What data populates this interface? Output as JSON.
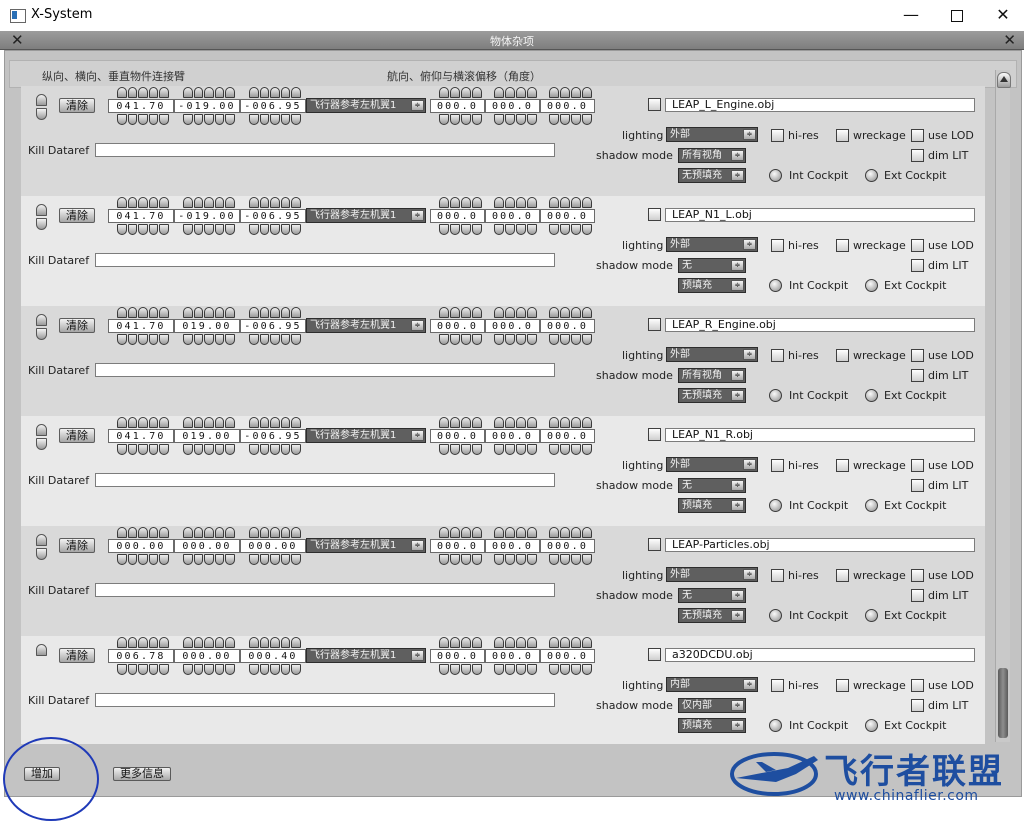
{
  "window": {
    "title": "X-System"
  },
  "panel": {
    "title": "物体杂项"
  },
  "headers": {
    "arms": "纵向、横向、垂直物件连接臂",
    "offsets": "航向、俯仰与横滚偏移（角度）"
  },
  "labels": {
    "clear": "清除",
    "kill_dataref": "Kill Dataref",
    "lighting": "lighting",
    "hi_res": "hi-res",
    "wreckage": "wreckage",
    "use_lod": "use LOD",
    "shadow_mode": "shadow mode",
    "dim_lit": "dim LIT",
    "int_cockpit": "Int Cockpit",
    "ext_cockpit": "Ext Cockpit",
    "caret": "≑"
  },
  "rows": [
    {
      "x": "041.70",
      "y": "-019.00",
      "z": "-006.95",
      "attach": "飞行器参考左机翼1",
      "h": "000.0",
      "p": "000.0",
      "r": "000.0",
      "file": "LEAP_L_Engine.obj",
      "lighting": "外部",
      "shadow": "所有视角",
      "fill": "无预填充",
      "grip": "both"
    },
    {
      "x": "041.70",
      "y": "-019.00",
      "z": "-006.95",
      "attach": "飞行器参考左机翼1",
      "h": "000.0",
      "p": "000.0",
      "r": "000.0",
      "file": "LEAP_N1_L.obj",
      "lighting": "外部",
      "shadow": "无",
      "fill": "预填充",
      "grip": "both"
    },
    {
      "x": "041.70",
      "y": "019.00",
      "z": "-006.95",
      "attach": "飞行器参考左机翼1",
      "h": "000.0",
      "p": "000.0",
      "r": "000.0",
      "file": "LEAP_R_Engine.obj",
      "lighting": "外部",
      "shadow": "所有视角",
      "fill": "无预填充",
      "grip": "both"
    },
    {
      "x": "041.70",
      "y": "019.00",
      "z": "-006.95",
      "attach": "飞行器参考左机翼1",
      "h": "000.0",
      "p": "000.0",
      "r": "000.0",
      "file": "LEAP_N1_R.obj",
      "lighting": "外部",
      "shadow": "无",
      "fill": "预填充",
      "grip": "both"
    },
    {
      "x": "000.00",
      "y": "000.00",
      "z": "000.00",
      "attach": "飞行器参考左机翼1",
      "h": "000.0",
      "p": "000.0",
      "r": "000.0",
      "file": "LEAP-Particles.obj",
      "lighting": "外部",
      "shadow": "无",
      "fill": "无预填充",
      "grip": "both"
    },
    {
      "x": "006.78",
      "y": "000.00",
      "z": "000.40",
      "attach": "飞行器参考左机翼1",
      "h": "000.0",
      "p": "000.0",
      "r": "000.0",
      "file": "a320DCDU.obj",
      "lighting": "内部",
      "shadow": "仅内部",
      "fill": "预填充",
      "grip": "up"
    }
  ],
  "bottom": {
    "add": "增加",
    "more_info": "更多信息"
  },
  "watermark": {
    "name": "飞行者联盟",
    "url": "www.chinaflier.com"
  }
}
